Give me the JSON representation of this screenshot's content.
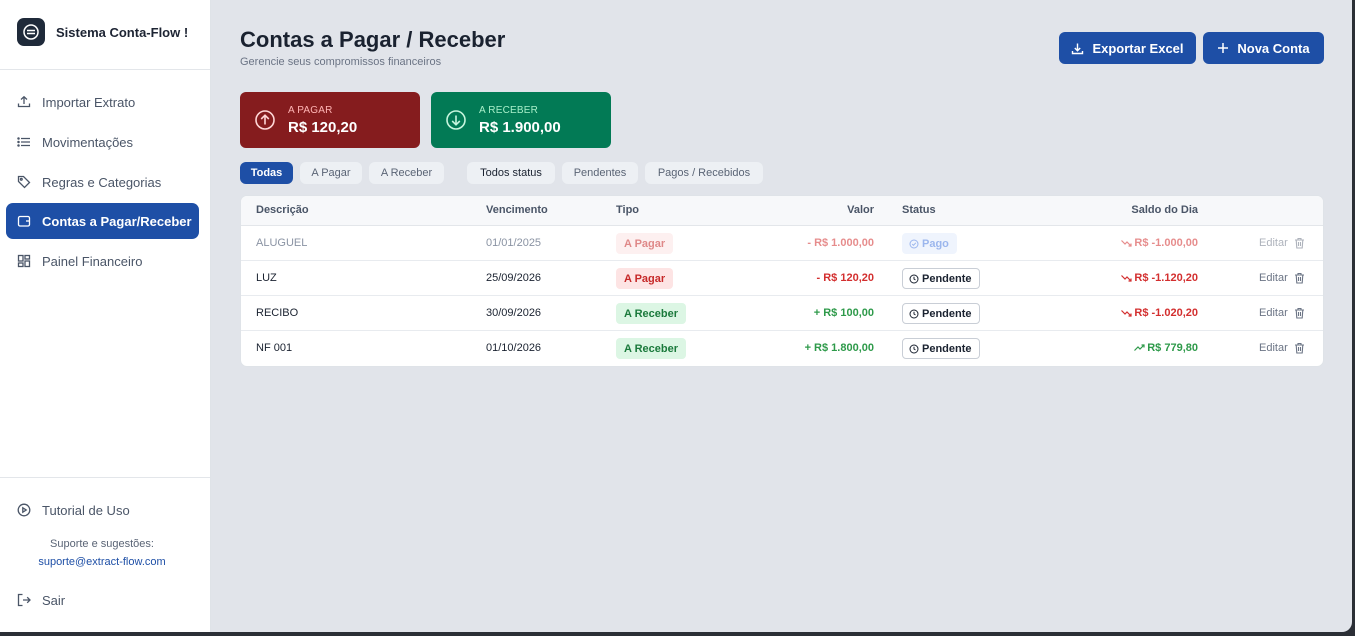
{
  "app": {
    "title": "Sistema Conta-Flow !"
  },
  "sidebar": {
    "items": [
      {
        "label": "Importar Extrato",
        "icon": "upload-icon"
      },
      {
        "label": "Movimentações",
        "icon": "list-icon"
      },
      {
        "label": "Regras e Categorias",
        "icon": "tag-icon"
      },
      {
        "label": "Contas a Pagar/Receber",
        "icon": "wallet-icon",
        "active": true
      },
      {
        "label": "Painel Financeiro",
        "icon": "dashboard-icon"
      }
    ],
    "tutorial": "Tutorial de Uso",
    "support_label": "Suporte e sugestões:",
    "support_email": "suporte@extract-flow.com",
    "logout": "Sair"
  },
  "header": {
    "title": "Contas a Pagar / Receber",
    "subtitle": "Gerencie seus compromissos financeiros",
    "export_label": "Exportar Excel",
    "new_label": "Nova Conta"
  },
  "summary": {
    "pagar": {
      "label": "A PAGAR",
      "value": "R$ 120,20",
      "color": "#851c1e"
    },
    "receber": {
      "label": "A RECEBER",
      "value": "R$ 1.900,00",
      "color": "#027a55"
    }
  },
  "filters": {
    "tipo": [
      "Todas",
      "A Pagar",
      "A Receber"
    ],
    "status": [
      "Todos status",
      "Pendentes",
      "Pagos / Recebidos"
    ]
  },
  "table": {
    "columns": [
      "Descrição",
      "Vencimento",
      "Tipo",
      "Valor",
      "Status",
      "Saldo do Dia"
    ],
    "edit_label": "Editar",
    "rows": [
      {
        "descricao": "ALUGUEL",
        "vencimento": "01/01/2025",
        "tipo": "A Pagar",
        "valor": "- R$ 1.000,00",
        "status": "Pago",
        "saldo": "R$ -1.000,00"
      },
      {
        "descricao": "LUZ",
        "vencimento": "25/09/2026",
        "tipo": "A Pagar",
        "valor": "- R$ 120,20",
        "status": "Pendente",
        "saldo": "R$ -1.120,20"
      },
      {
        "descricao": "RECIBO",
        "vencimento": "30/09/2026",
        "tipo": "A Receber",
        "valor": "+ R$ 100,00",
        "status": "Pendente",
        "saldo": "R$ -1.020,20"
      },
      {
        "descricao": "NF 001",
        "vencimento": "01/10/2026",
        "tipo": "A Receber",
        "valor": "+ R$ 1.800,00",
        "status": "Pendente",
        "saldo": "R$ 779,80"
      }
    ]
  },
  "colors": {
    "primary": "#1e4fa6",
    "background": "#e1e4ea",
    "negative": "#d32f2f",
    "positive": "#2e9a4a"
  }
}
